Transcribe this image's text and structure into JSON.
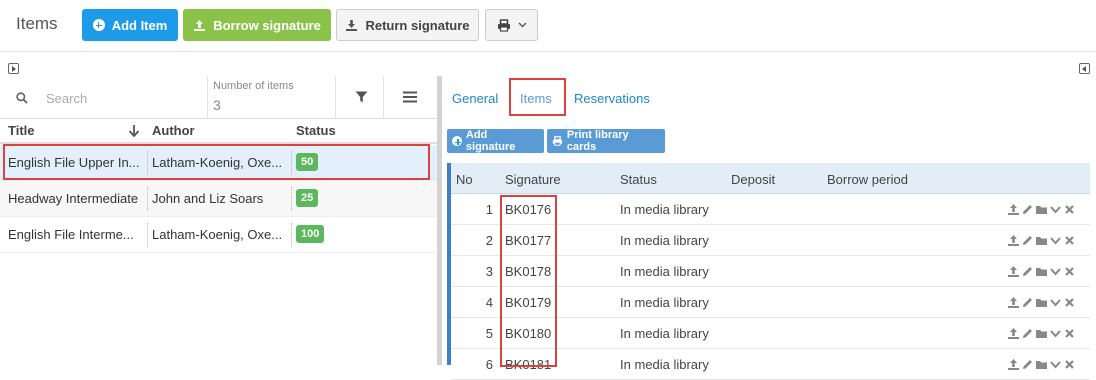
{
  "header": {
    "title": "Items",
    "add_item_label": "Add Item",
    "borrow_label": "Borrow signature",
    "return_label": "Return signature"
  },
  "list": {
    "search_placeholder": "Search",
    "count_label": "Number of items",
    "count_value": "3",
    "columns": [
      "Title",
      "Author",
      "Status"
    ],
    "rows": [
      {
        "title": "English File Upper In...",
        "author": "Latham-Koenig, Oxe...",
        "status": "50"
      },
      {
        "title": "Headway Intermediate",
        "author": "John and Liz Soars",
        "status": "25"
      },
      {
        "title": "English File Interme...",
        "author": "Latham-Koenig, Oxe...",
        "status": "100"
      }
    ]
  },
  "detail": {
    "tabs": [
      "General",
      "Items",
      "Reservations"
    ],
    "active_tab": "Items",
    "add_signature_label": "Add signature",
    "print_cards_label": "Print library cards",
    "columns": [
      "No",
      "Signature",
      "Status",
      "Deposit",
      "Borrow period"
    ],
    "rows": [
      {
        "no": "1",
        "signature": "BK0176",
        "status": "In media library"
      },
      {
        "no": "2",
        "signature": "BK0177",
        "status": "In media library"
      },
      {
        "no": "3",
        "signature": "BK0178",
        "status": "In media library"
      },
      {
        "no": "4",
        "signature": "BK0179",
        "status": "In media library"
      },
      {
        "no": "5",
        "signature": "BK0180",
        "status": "In media library"
      },
      {
        "no": "6",
        "signature": "BK0181",
        "status": "In media library"
      }
    ]
  },
  "colors": {
    "primary": "#1e9be8",
    "success": "#8bc34a",
    "highlight": "#d9423f",
    "badge": "#5cb85c",
    "link": "#1e88c8"
  }
}
